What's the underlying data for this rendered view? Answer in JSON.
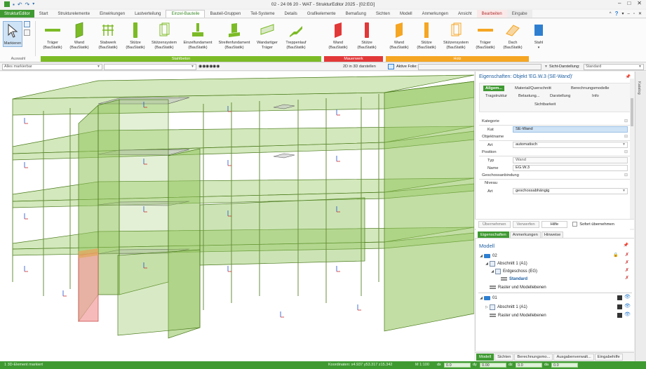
{
  "window": {
    "title": "02 - 24 06 20 - WAT - StrukturEditor 2025 - [02:EG]",
    "controls": [
      "–",
      "□",
      "✕"
    ]
  },
  "tabs": {
    "file": "StrukturEditor",
    "items": [
      "Start",
      "Strukturelemente",
      "Einwirkungen",
      "Lastverteilung",
      "Einzel-Bauteile",
      "Bauteil-Gruppen",
      "Teil-Systeme",
      "Details",
      "Grafikelemente",
      "Bemaßung",
      "Sichten",
      "Modell",
      "Anmerkungen",
      "Ansicht",
      "Bearbeiten",
      "Eingabe"
    ],
    "active": "Einzel-Bauteile",
    "help": "?"
  },
  "ribbon": {
    "auswahl": {
      "label": "Markieren",
      "group": "Auswahl"
    },
    "stahlbeton": {
      "group": "Stahlbeton",
      "buttons": [
        {
          "l1": "Träger",
          "l2": "(BauStatik)",
          "icon": "beam-icon"
        },
        {
          "l1": "Wand",
          "l2": "(BauStatik)",
          "icon": "wall-icon"
        },
        {
          "l1": "Stabwerk",
          "l2": "(BauStatik)",
          "icon": "frame-icon"
        },
        {
          "l1": "Stütze",
          "l2": "(BauStatik)",
          "icon": "column-icon"
        },
        {
          "l1": "Stützensystem",
          "l2": "(BauStatik)",
          "icon": "column-system-icon"
        },
        {
          "l1": "Einzelfundament",
          "l2": "(BauStatik)",
          "icon": "single-footing-icon"
        },
        {
          "l1": "Streifenfundament",
          "l2": "(BauStatik)",
          "icon": "strip-footing-icon"
        },
        {
          "l1": "Wandartiger",
          "l2": "Träger",
          "icon": "deep-beam-icon"
        },
        {
          "l1": "Treppenlauf",
          "l2": "(BauStatik)",
          "icon": "stair-icon"
        }
      ]
    },
    "mauerwerk": {
      "group": "Mauerwerk",
      "buttons": [
        {
          "l1": "Wand",
          "l2": "(BauStatik)",
          "icon": "masonry-wall-icon"
        },
        {
          "l1": "Stütze",
          "l2": "(BauStatik)",
          "icon": "masonry-column-icon"
        }
      ]
    },
    "holz": {
      "group": "Holz",
      "buttons": [
        {
          "l1": "Wand",
          "l2": "(BauStatik)",
          "icon": "timber-wall-icon"
        },
        {
          "l1": "Stütze",
          "l2": "(BauStatik)",
          "icon": "timber-column-icon"
        },
        {
          "l1": "Stützensystem",
          "l2": "(BauStatik)",
          "icon": "timber-column-system-icon"
        },
        {
          "l1": "Träger",
          "l2": "(BauStatik)",
          "icon": "timber-beam-icon"
        },
        {
          "l1": "Dach",
          "l2": "(BauStatik)",
          "icon": "roof-icon"
        }
      ]
    },
    "stahl": {
      "l1": "Stahl",
      "icon": "steel-icon"
    },
    "colors": {
      "stahlbeton": "#7cbb26",
      "mauerwerk": "#e23838",
      "holz": "#f5a623",
      "stahl": "#2f7fd1"
    }
  },
  "filterbar": {
    "filter": "Alles markierbar",
    "second": "",
    "btn_2d3d": "2D in 3D darstellen",
    "aktive_folie": "Aktive Folie:",
    "sicht_label": "Sicht-Darstellung:",
    "sicht_value": "Standard"
  },
  "properties": {
    "title": "Eigenschaften: Objekt 'EG.W.3 (SE-Wand)'",
    "tabs": [
      "Allgem...",
      "Material/Querschnitt",
      "Berechnungsmodelle",
      "Tragstruktur",
      "Belastung...",
      "Darstellung",
      "Info",
      "Sichtbarkeit"
    ],
    "sections": {
      "kategorie": "Kategorie",
      "objektname": "Objektname",
      "position": "Position",
      "geschoss": "Geschossanbindung",
      "niveau": "Niveau"
    },
    "fields": {
      "kat_key": "Kat",
      "kat_val": "SE-Wand",
      "art_key": "Art",
      "art_val": "automatisch",
      "typ_key": "Typ",
      "typ_val": "Wand",
      "name_key": "Name",
      "name_val": "EG.W.3",
      "niveau_art_key": "Art",
      "niveau_art_val": "geschossabhängig"
    },
    "actions": {
      "apply": "Übernehmen",
      "discard": "Verwerfen",
      "help": "Hilfe",
      "instant": "Sofort übernehmen"
    },
    "subtabs": [
      "Eigenschaften",
      "Anmerkungen",
      "Hinweise"
    ]
  },
  "model": {
    "title": "Modell",
    "nodes": {
      "n02": "02",
      "abschnitt1": "Abschnitt 1 (A1)",
      "eg": "Erdgeschoss (EG)",
      "standard": "Standard",
      "raster": "Raster und Modellebenen",
      "n01": "01",
      "abschnitt1b": "Abschnitt 1 (A1)",
      "rasterb": "Raster und Modellebenen"
    }
  },
  "bottomtabs": [
    "Modell",
    "Sichten",
    "Berechnungsmo...",
    "Ausgabenverwalt...",
    "Eingabehilfe"
  ],
  "sidebar": {
    "label": "Katalog"
  },
  "status": {
    "msg": "1 3D-Element markiert",
    "coords": "Koordinaten: x4.937 y53.317 z15.342",
    "scale": "M 1:100",
    "dx": "0.0",
    "dy": "0.00",
    "dz": "0.0",
    "da": "0.0"
  }
}
